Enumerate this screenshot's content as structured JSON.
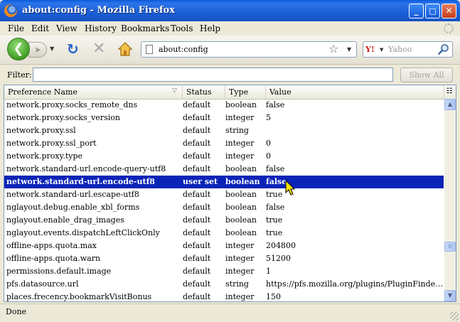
{
  "window": {
    "title": "about:config - Mozilla Firefox",
    "controls": {
      "minimize": "_",
      "maximize": "□",
      "close": "✕"
    }
  },
  "menu": {
    "items": [
      {
        "label": "File",
        "accel": "F"
      },
      {
        "label": "Edit",
        "accel": "E"
      },
      {
        "label": "View",
        "accel": "V"
      },
      {
        "label": "History",
        "accel": "s"
      },
      {
        "label": "Bookmarks",
        "accel": "B"
      },
      {
        "label": "Tools",
        "accel": "T"
      },
      {
        "label": "Help",
        "accel": "H"
      }
    ]
  },
  "toolbar": {
    "back_icon": "back-arrow-icon",
    "forward_icon": "forward-arrow-icon",
    "reload_icon": "reload-icon",
    "stop_icon": "stop-icon",
    "home_icon": "home-icon",
    "url": "about:config",
    "search_engine": "Y!",
    "search_placeholder": "Yahoo"
  },
  "filter": {
    "label": "Filter:",
    "value": "",
    "show_all_label": "Show All"
  },
  "table": {
    "columns": [
      "Preference Name",
      "Status",
      "Type",
      "Value"
    ],
    "rows": [
      {
        "name": "network.proxy.socks_remote_dns",
        "status": "default",
        "type": "boolean",
        "value": "false"
      },
      {
        "name": "network.proxy.socks_version",
        "status": "default",
        "type": "integer",
        "value": "5"
      },
      {
        "name": "network.proxy.ssl",
        "status": "default",
        "type": "string",
        "value": ""
      },
      {
        "name": "network.proxy.ssl_port",
        "status": "default",
        "type": "integer",
        "value": "0"
      },
      {
        "name": "network.proxy.type",
        "status": "default",
        "type": "integer",
        "value": "0"
      },
      {
        "name": "network.standard-url.encode-query-utf8",
        "status": "default",
        "type": "boolean",
        "value": "false"
      },
      {
        "name": "network.standard-url.encode-utf8",
        "status": "user set",
        "type": "boolean",
        "value": "false",
        "selected": true
      },
      {
        "name": "network.standard-url.escape-utf8",
        "status": "default",
        "type": "boolean",
        "value": "true"
      },
      {
        "name": "nglayout.debug.enable_xbl_forms",
        "status": "default",
        "type": "boolean",
        "value": "false"
      },
      {
        "name": "nglayout.enable_drag_images",
        "status": "default",
        "type": "boolean",
        "value": "true"
      },
      {
        "name": "nglayout.events.dispatchLeftClickOnly",
        "status": "default",
        "type": "boolean",
        "value": "true"
      },
      {
        "name": "offline-apps.quota.max",
        "status": "default",
        "type": "integer",
        "value": "204800"
      },
      {
        "name": "offline-apps.quota.warn",
        "status": "default",
        "type": "integer",
        "value": "51200"
      },
      {
        "name": "permissions.default.image",
        "status": "default",
        "type": "integer",
        "value": "1"
      },
      {
        "name": "pfs.datasource.url",
        "status": "default",
        "type": "string",
        "value": "https://pfs.mozilla.org/plugins/PluginFinderService…"
      },
      {
        "name": "places.frecency.bookmarkVisitBonus",
        "status": "default",
        "type": "integer",
        "value": "150"
      }
    ]
  },
  "status": {
    "text": "Done"
  },
  "colors": {
    "selection": "#0a24b7",
    "titlebar": "#1a5fd6",
    "chrome": "#ece9d8"
  }
}
